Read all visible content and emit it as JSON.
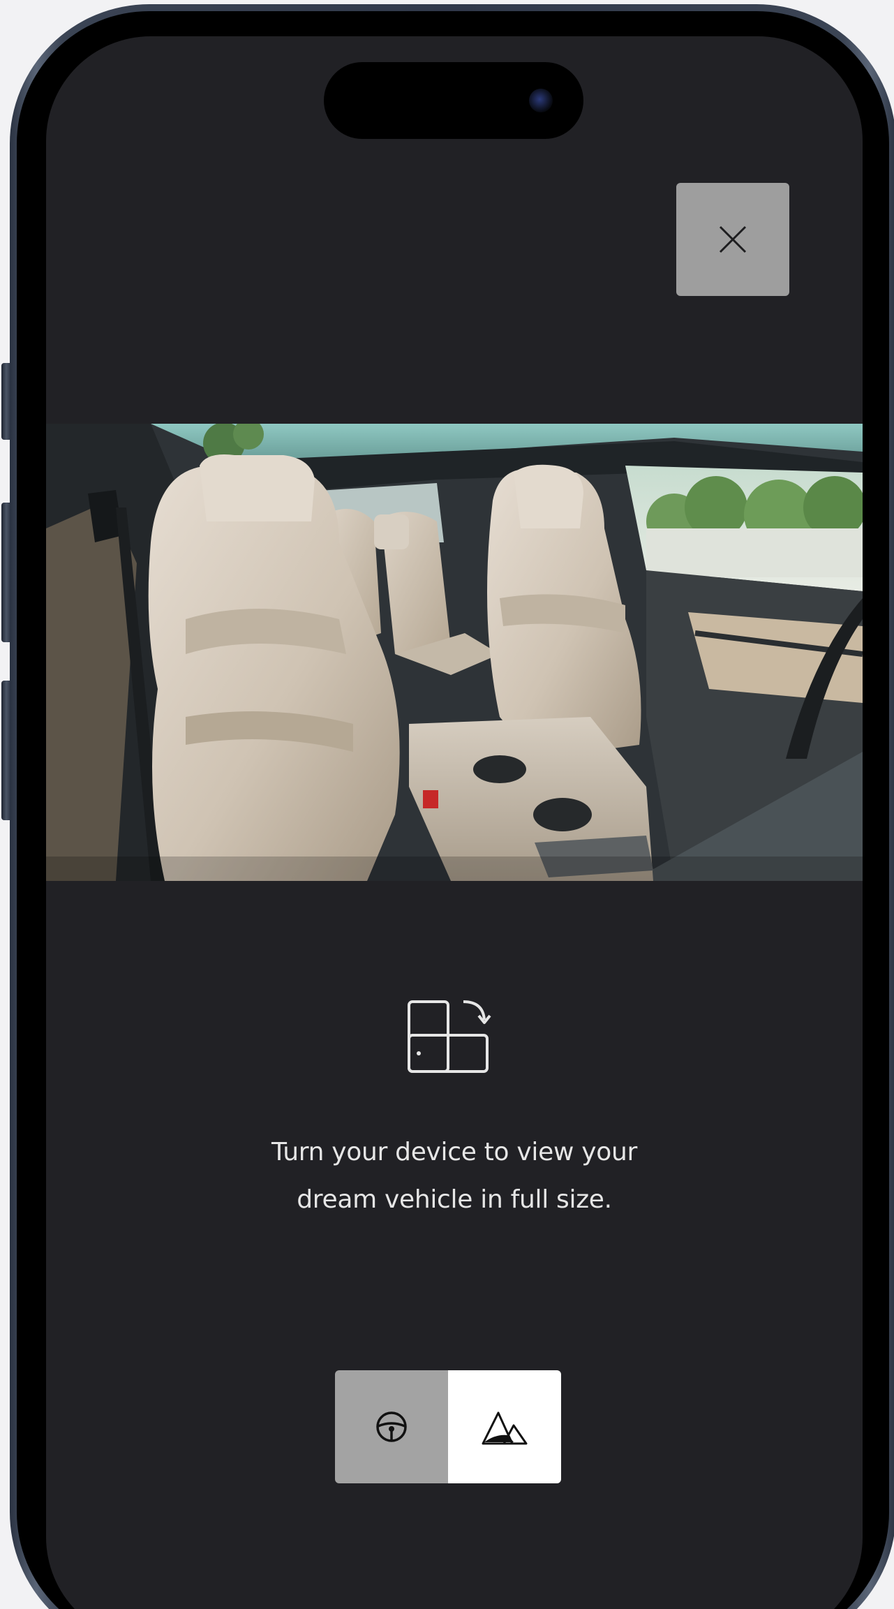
{
  "overlay": {
    "close_label": "Close",
    "hint_line1": "Turn your device to view your",
    "hint_line2": "dream vehicle in full size."
  },
  "view_toggle": {
    "options": [
      {
        "name": "interior",
        "icon": "steering-wheel-icon",
        "selected": false
      },
      {
        "name": "exterior",
        "icon": "mountains-icon",
        "selected": true
      }
    ]
  },
  "icons": {
    "close": "close-icon",
    "rotate": "rotate-device-icon",
    "interior": "steering-wheel-icon",
    "exterior": "mountains-icon"
  },
  "colors": {
    "screen_background": "#212125",
    "close_button": "#9e9e9e",
    "toggle_inactive": "#a3a3a3",
    "toggle_active": "#ffffff",
    "text": "#e6e6e6"
  }
}
